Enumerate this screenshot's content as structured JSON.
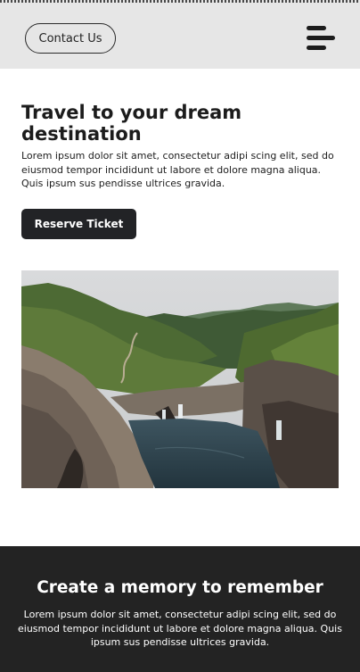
{
  "header": {
    "contact_label": "Contact Us",
    "menu_icon": "hamburger-menu-icon"
  },
  "hero": {
    "title": "Travel to your dream destination",
    "text": "Lorem ipsum dolor sit amet, consectetur adipi scing elit, sed do eiusmod tempor incididunt ut labore et dolore magna aliqua. Quis ipsum sus pendisse ultrices gravida.",
    "button_label": "Reserve Ticket"
  },
  "footer": {
    "title": "Create a memory to remember",
    "text": "Lorem ipsum dolor sit amet, consectetur adipi scing elit, sed do eiusmod tempor incididunt ut labore et dolore magna aliqua. Quis ipsum sus pendisse ultrices gravida."
  },
  "colors": {
    "header_bg": "#e6e6e6",
    "button_bg": "#222326",
    "footer_bg": "#232323"
  }
}
